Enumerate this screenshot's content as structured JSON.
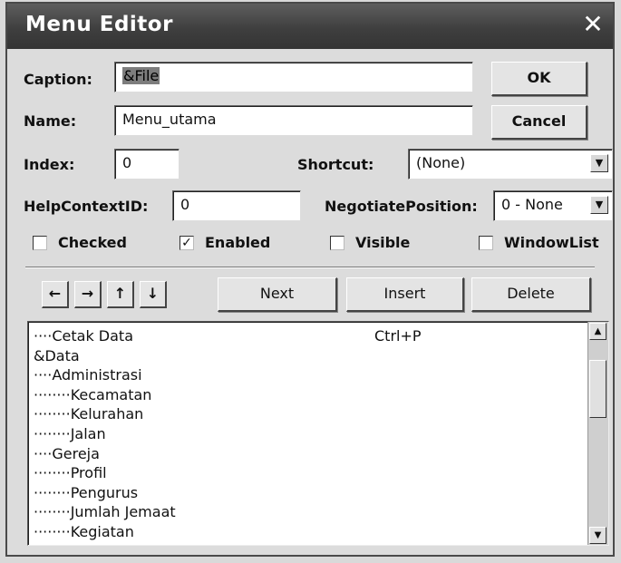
{
  "window": {
    "title": "Menu Editor",
    "close_glyph": "✕"
  },
  "form": {
    "caption_label": "Caption:",
    "caption_value": "&File",
    "name_label": "Name:",
    "name_value": "Menu_utama",
    "index_label": "Index:",
    "index_value": "0",
    "shortcut_label": "Shortcut:",
    "shortcut_value": "(None)",
    "helpcontext_label": "HelpContextID:",
    "helpcontext_value": "0",
    "negotiate_label": "NegotiatePosition:",
    "negotiate_value": "0 - None"
  },
  "buttons": {
    "ok": "OK",
    "cancel": "Cancel",
    "next": "Next",
    "insert": "Insert",
    "delete": "Delete"
  },
  "checkboxes": [
    {
      "label": "Checked",
      "checked": false
    },
    {
      "label": "Enabled",
      "checked": true
    },
    {
      "label": "Visible",
      "checked": false
    },
    {
      "label": "WindowList",
      "checked": false
    }
  ],
  "arrows": [
    "←",
    "→",
    "↑",
    "↓"
  ],
  "menu_list": [
    {
      "text": "····Cetak Data",
      "shortcut": "Ctrl+P"
    },
    {
      "text": "&Data",
      "shortcut": ""
    },
    {
      "text": "····Administrasi",
      "shortcut": ""
    },
    {
      "text": "········Kecamatan",
      "shortcut": ""
    },
    {
      "text": "········Kelurahan",
      "shortcut": ""
    },
    {
      "text": "········Jalan",
      "shortcut": ""
    },
    {
      "text": "····Gereja",
      "shortcut": ""
    },
    {
      "text": "········Profil",
      "shortcut": ""
    },
    {
      "text": "········Pengurus",
      "shortcut": ""
    },
    {
      "text": "········Jumlah Jemaat",
      "shortcut": ""
    },
    {
      "text": "········Kegiatan",
      "shortcut": ""
    }
  ],
  "icons": {
    "dropdown": "dropdown-arrow-icon",
    "scroll_up": "scroll-up-icon",
    "scroll_down": "scroll-down-icon",
    "check_mark": "✓"
  }
}
